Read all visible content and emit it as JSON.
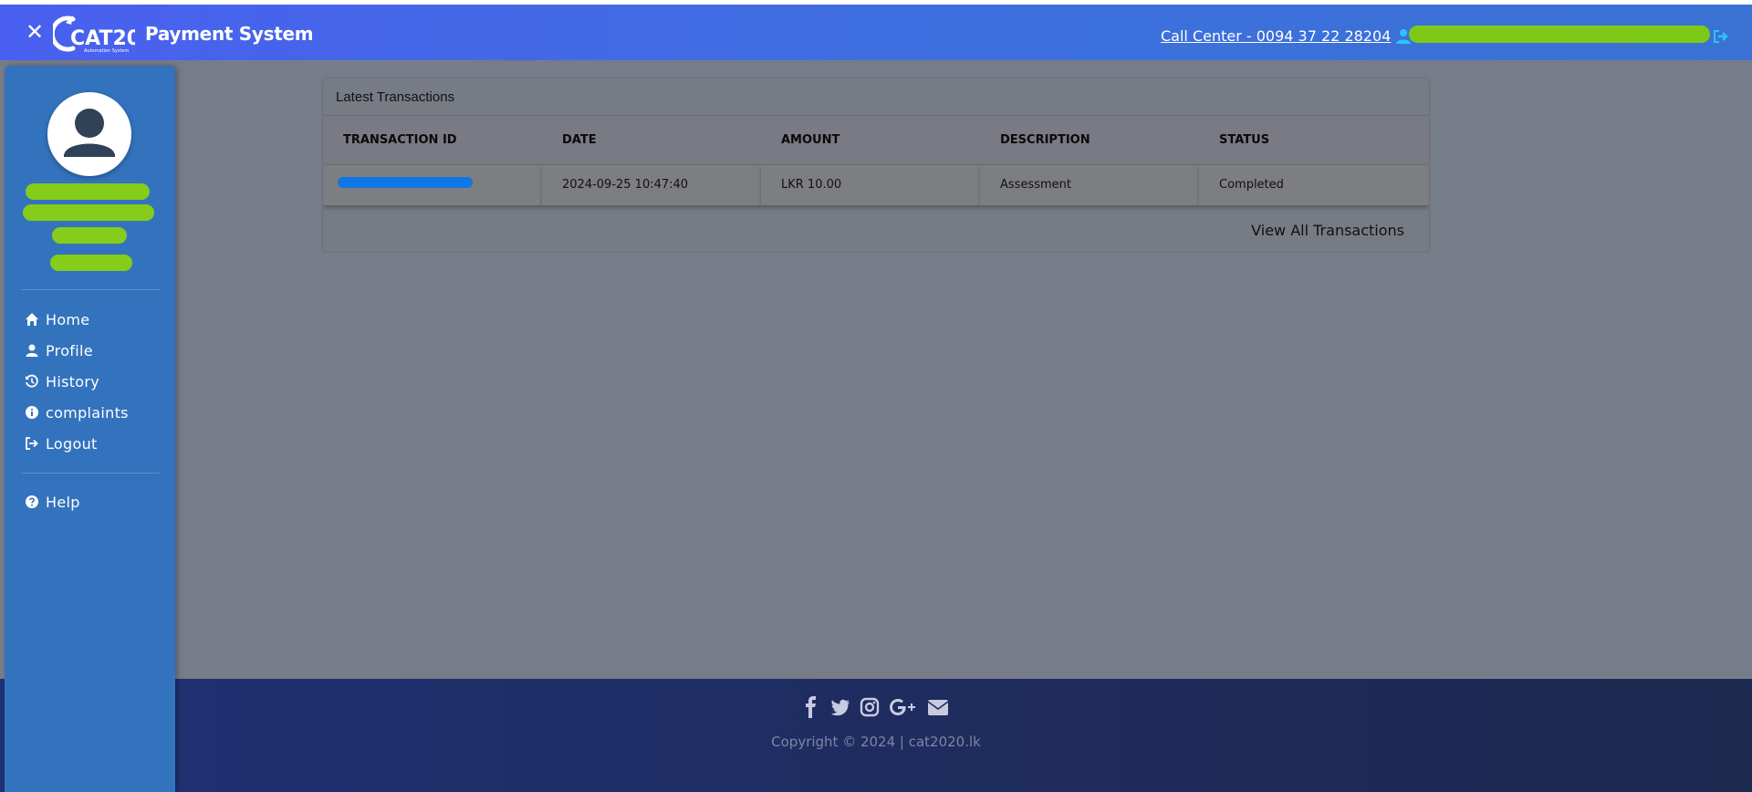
{
  "header": {
    "close_symbol": "✕",
    "logo_text": "CAT20",
    "logo_subtitle": "Automation System",
    "app_title": "Payment System",
    "call_center": "Call Center - 0094 37 22 28204",
    "user_name": "",
    "accent_color": "#4a60f0"
  },
  "sidebar": {
    "user_name": "",
    "items": [
      {
        "label": "Home",
        "icon": "home-icon"
      },
      {
        "label": "Profile",
        "icon": "user-icon"
      },
      {
        "label": "History",
        "icon": "history-icon"
      },
      {
        "label": "complaints",
        "icon": "info-icon"
      },
      {
        "label": "Logout",
        "icon": "logout-icon"
      }
    ],
    "help": {
      "label": "Help",
      "icon": "question-icon"
    },
    "background_color": "#3373be"
  },
  "transactions": {
    "title": "Latest Transactions",
    "columns": [
      "TRANSACTION ID",
      "DATE",
      "AMOUNT",
      "DESCRIPTION",
      "STATUS"
    ],
    "rows": [
      {
        "id": "",
        "date": "2024-09-25 10:47:40",
        "amount": "LKR 10.00",
        "description": "Assessment",
        "status": "Completed"
      }
    ],
    "view_all": "View All Transactions",
    "status_color": "#0e6b0e"
  },
  "footer": {
    "social": [
      "facebook-icon",
      "twitter-icon",
      "instagram-icon",
      "google-plus-icon",
      "email-icon"
    ],
    "copyright": "Copyright © 2024 | cat2020.lk"
  }
}
